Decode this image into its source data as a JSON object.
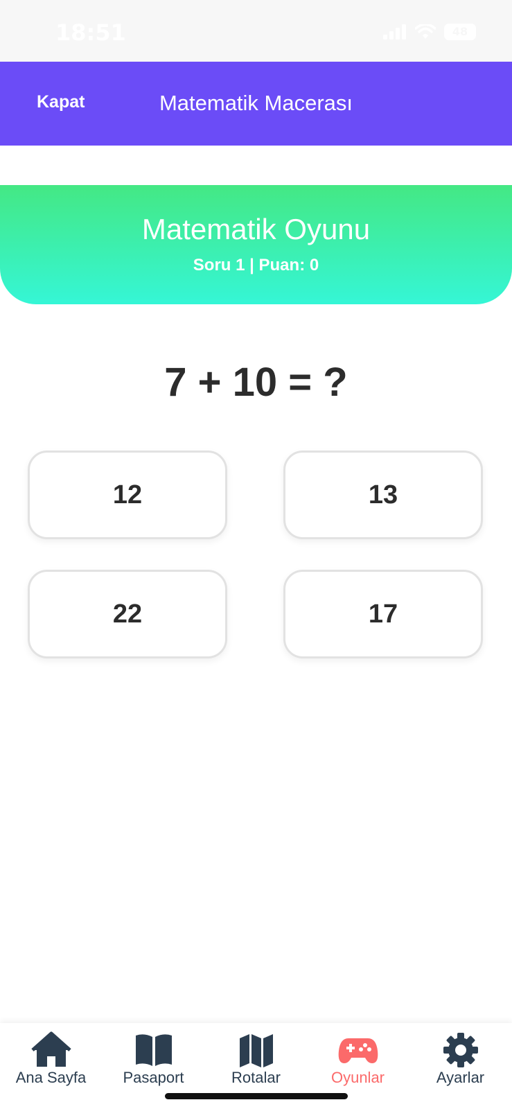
{
  "status_bar": {
    "time": "18:51",
    "battery": "48"
  },
  "nav": {
    "close_label": "Kapat",
    "title": "Matematik Macerası"
  },
  "game": {
    "title": "Matematik Oyunu",
    "subtitle": "Soru 1 | Puan: 0"
  },
  "question": "7 + 10 = ?",
  "answers": [
    "12",
    "13",
    "22",
    "17"
  ],
  "tabs": [
    {
      "label": "Ana Sayfa",
      "icon": "home-icon"
    },
    {
      "label": "Pasaport",
      "icon": "book-icon"
    },
    {
      "label": "Rotalar",
      "icon": "map-icon"
    },
    {
      "label": "Oyunlar",
      "icon": "gamepad-icon",
      "active": true
    },
    {
      "label": "Ayarlar",
      "icon": "gear-icon"
    }
  ],
  "colors": {
    "nav_bg": "#6b4cf7",
    "header_gradient_top": "#44e884",
    "header_gradient_bottom": "#35f6d6",
    "tab_active": "#fb6a6a",
    "tab_inactive": "#2c3e50"
  }
}
